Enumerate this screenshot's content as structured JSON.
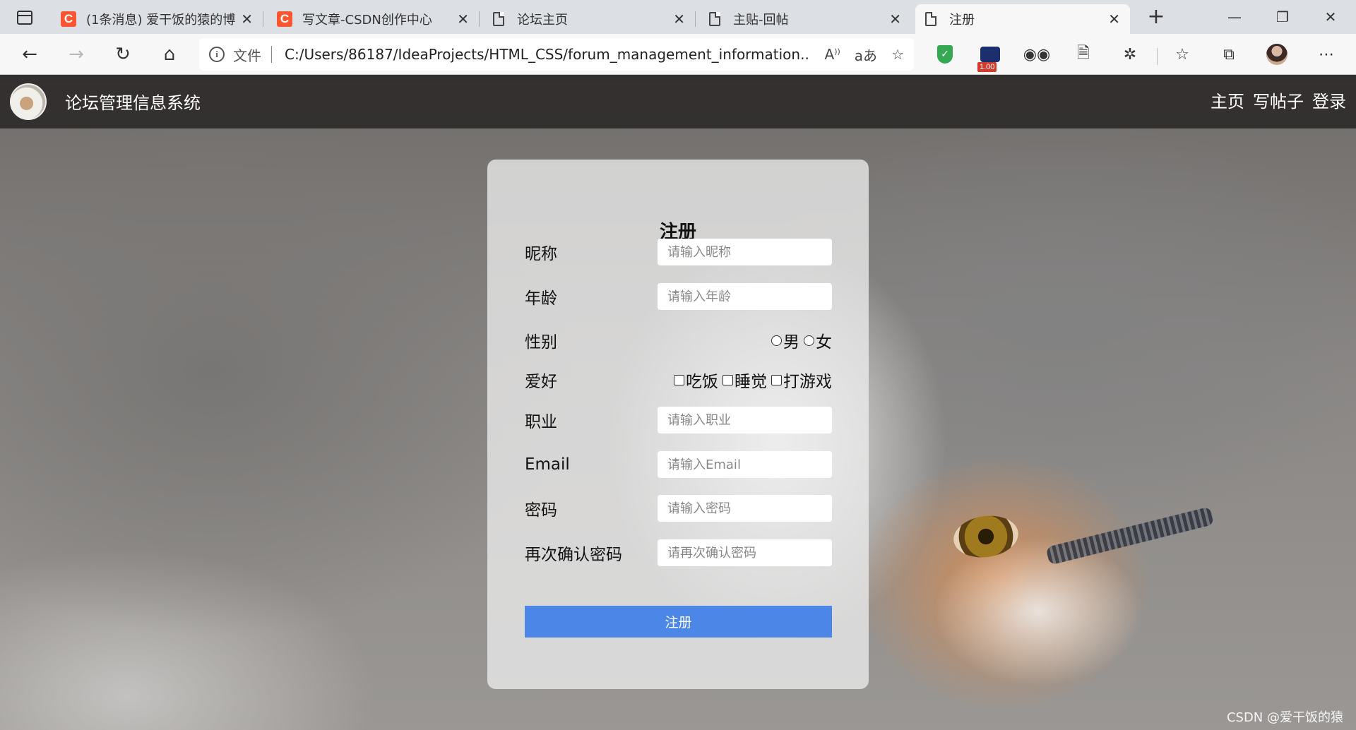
{
  "browser": {
    "tabs": [
      {
        "title": "(1条消息) 爱干饭的猿的博",
        "favicon": "csdn-icon"
      },
      {
        "title": "写文章-CSDN创作中心",
        "favicon": "csdn-icon"
      },
      {
        "title": "论坛主页",
        "favicon": "document-icon"
      },
      {
        "title": "主贴-回帖",
        "favicon": "document-icon"
      },
      {
        "title": "注册",
        "favicon": "document-icon",
        "active": true
      }
    ],
    "address": {
      "scheme_label": "文件",
      "url": "C:/Users/86187/IdeaProjects/HTML_CSS/forum_management_information..."
    },
    "extension_badge": "1.00",
    "colors": {
      "csdn": "#fc5531",
      "shield": "#35a853"
    }
  },
  "site": {
    "title": "论坛管理信息系统",
    "nav": [
      "主页",
      "写帖子",
      "登录"
    ]
  },
  "form": {
    "heading": "注册",
    "fields": {
      "nickname": {
        "label": "昵称",
        "placeholder": "请输入昵称"
      },
      "age": {
        "label": "年龄",
        "placeholder": "请输入年龄"
      },
      "gender": {
        "label": "性别",
        "options": [
          "男",
          "女"
        ]
      },
      "hobby": {
        "label": "爱好",
        "options": [
          "吃饭",
          "睡觉",
          "打游戏"
        ]
      },
      "job": {
        "label": "职业",
        "placeholder": "请输入职业"
      },
      "email": {
        "label": "Email",
        "placeholder": "请输入Email"
      },
      "password": {
        "label": "密码",
        "placeholder": "请输入密码"
      },
      "confirm": {
        "label": "再次确认密码",
        "placeholder": "请再次确认密码"
      }
    },
    "submit_label": "注册",
    "accent_color": "#4c86e6"
  },
  "watermark": "CSDN @爱干饭的猿"
}
